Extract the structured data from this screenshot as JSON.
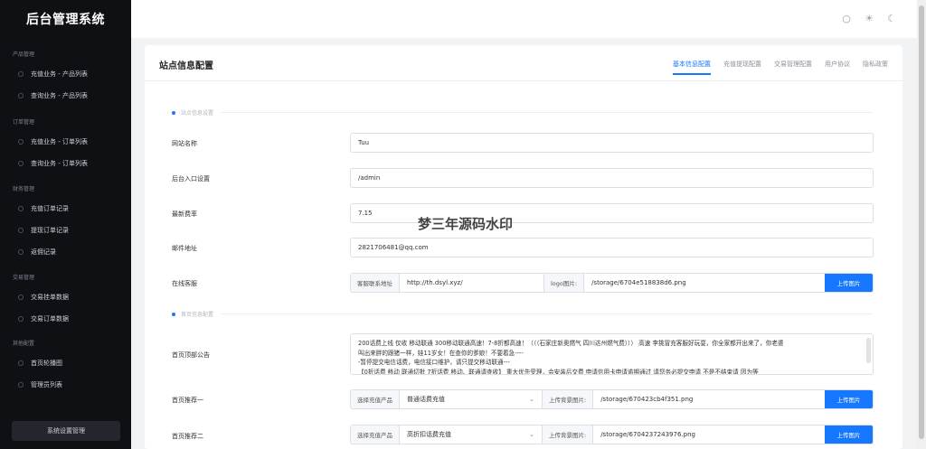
{
  "app": {
    "title": "后台管理系统"
  },
  "sidebar": {
    "groups": [
      {
        "title": "产品管理",
        "items": [
          "充值业务 - 产品列表",
          "查询业务 - 产品列表"
        ]
      },
      {
        "title": "订单管理",
        "items": [
          "充值业务 - 订单列表",
          "查询业务 - 订单列表"
        ]
      },
      {
        "title": "财务管理",
        "items": [
          "充值订单记录",
          "提现订单记录",
          "返佣记录"
        ]
      },
      {
        "title": "交易管理",
        "items": [
          "交易挂单数据",
          "交易订单数据"
        ]
      },
      {
        "title": "其他配置",
        "items": [
          "首页轮播图",
          "管理员列表"
        ]
      }
    ],
    "system_button": "系统设置管理"
  },
  "header": {
    "icons": [
      "refresh-icon",
      "sun-icon",
      "moon-icon"
    ]
  },
  "card": {
    "title": "站点信息配置",
    "tabs": [
      "基本信息配置",
      "充值提现配置",
      "交易管理配置",
      "用户协议",
      "隐私政策"
    ],
    "active_tab": 0,
    "sections": [
      "站点信息设置",
      "首页信息配置"
    ],
    "fields": {
      "site_name": {
        "label": "网站名称",
        "value": "Tuu"
      },
      "admin_entry": {
        "label": "后台入口设置",
        "value": "/admin"
      },
      "rate": {
        "label": "最新费率",
        "value": "7.15"
      },
      "email": {
        "label": "邮件地址",
        "value": "2821706481@qq.com"
      },
      "service": {
        "label": "在线客服",
        "link_addon": "客服联系地址",
        "link_value": "http://th.dsyl.xyz/",
        "logo_addon": "logo图片:",
        "logo_value": "/storage/6704e518838d6.png",
        "upload": "上传图片"
      },
      "notice": {
        "label": "首页顶部公告",
        "lines": [
          "200话费上线 仅收 移动联通 300移动联通高速！7-8折都高速！（（（石家庄新奥燃气 四川达州燃气费））） 高速 李挑冒充客服好玩耍，你全家都开出来了，你老婆",
          "叫出来胖的跟猪一样，娃11岁女！在查你的爹娘！不要着急----",
          "-暂停提交电信话费，电信接口维护，请只提交移动联通---",
          "【0折话费 移动 联通切批 7折话费 移动、联通请查收】 重大优先受理，会安装后交费  申请信用卡申请逾期通过 请您务必提交申请 不是不结束请  因为等"
        ]
      },
      "rec1": {
        "label": "首页推荐一",
        "select_addon": "选择充值产品",
        "select_value": "普通话费充值",
        "bg_addon": "上传背景图片:",
        "bg_value": "/storage/670423cb4f351.png",
        "upload": "上传图片"
      },
      "rec2": {
        "label": "首页推荐二",
        "select_addon": "选择充值产品",
        "select_value": "高折扣话费充值",
        "bg_addon": "上传背景图片:",
        "bg_value": "/storage/6704237243976.png",
        "upload": "上传图片"
      }
    }
  },
  "watermark": "梦三年源码水印"
}
